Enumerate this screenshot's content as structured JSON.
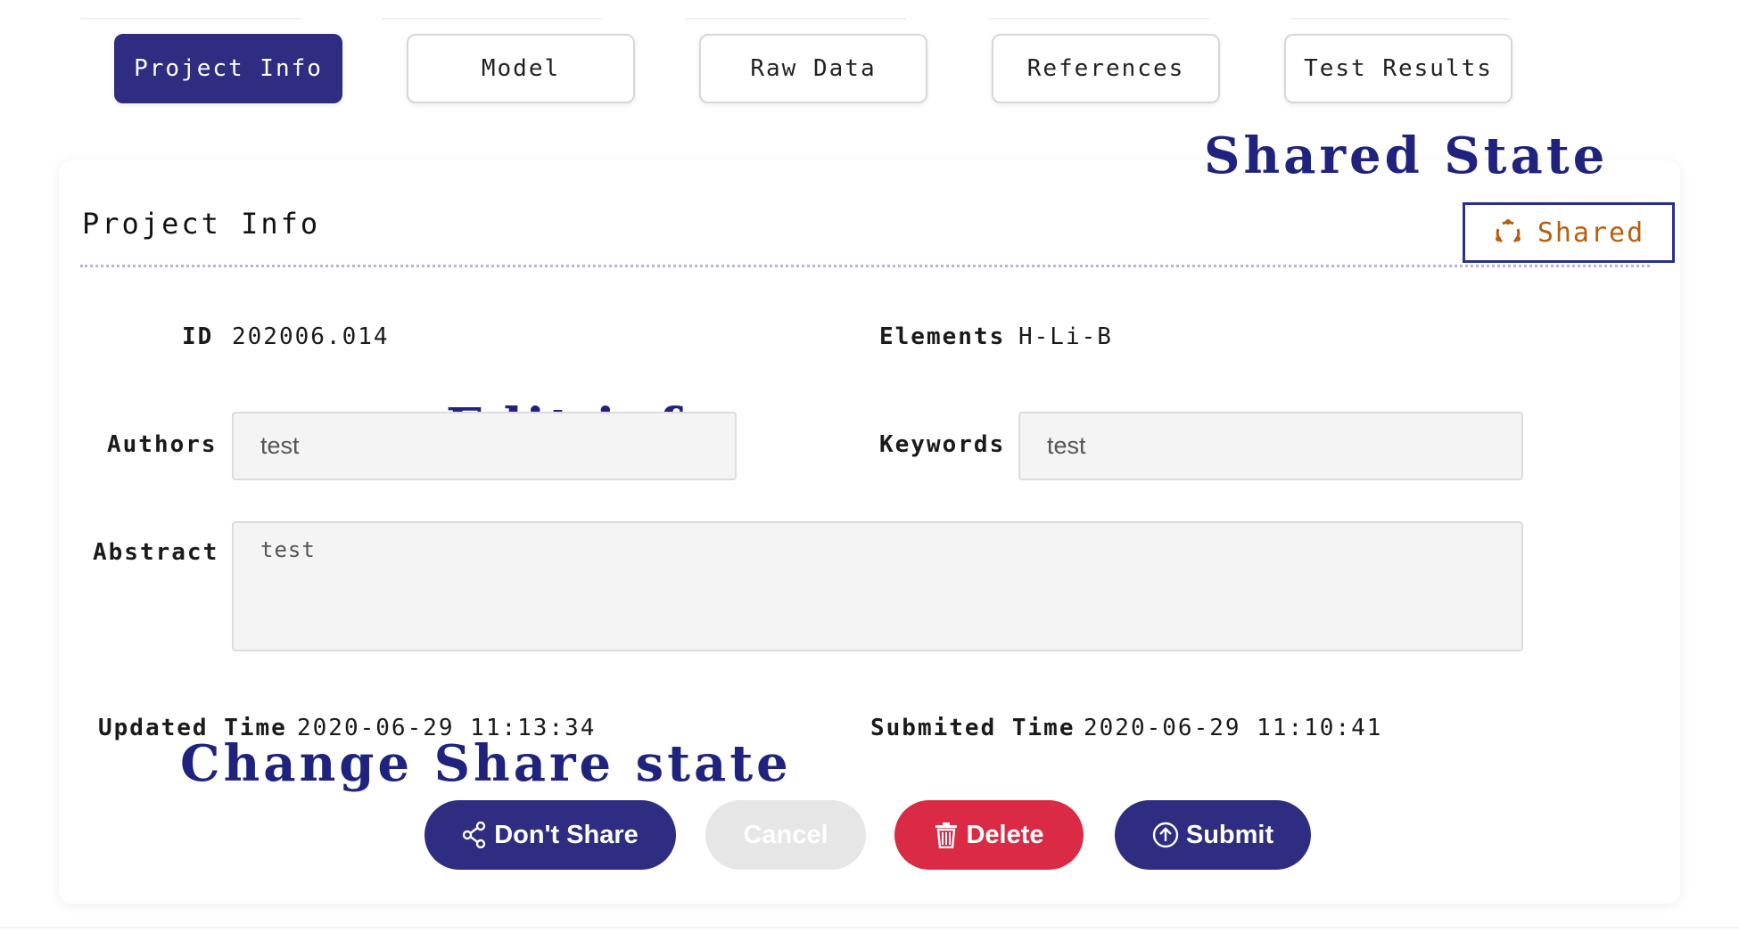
{
  "tabs": [
    {
      "label": "Project Info",
      "active": true
    },
    {
      "label": "Model",
      "active": false
    },
    {
      "label": "Raw Data",
      "active": false
    },
    {
      "label": "References",
      "active": false
    },
    {
      "label": "Test Results",
      "active": false
    }
  ],
  "section": {
    "title": "Project Info"
  },
  "share_badge": {
    "label": "Shared",
    "icon": "sync-circle-icon",
    "color": "#b95e0a"
  },
  "annotations": {
    "shared_state": "Shared State",
    "edit_info": "Edit info",
    "change_share_state": "Change Share state"
  },
  "fields": {
    "id_label": "ID",
    "id_value": "202006.014",
    "elements_label": "Elements",
    "elements_value": "H-Li-B",
    "authors_label": "Authors",
    "authors_value": "test",
    "keywords_label": "Keywords",
    "keywords_value": "test",
    "abstract_label": "Abstract",
    "abstract_value": "test",
    "updated_label": "Updated Time",
    "updated_value": "2020-06-29 11:13:34",
    "submitted_label": "Submited Time",
    "submitted_value": "2020-06-29 11:10:41"
  },
  "buttons": {
    "share": "Don't Share",
    "cancel": "Cancel",
    "delete": "Delete",
    "submit": "Submit"
  },
  "colors": {
    "primary": "#2e2d82",
    "danger": "#db2a45",
    "annotation": "#1f237d",
    "disabled": "#e6e6e6"
  }
}
